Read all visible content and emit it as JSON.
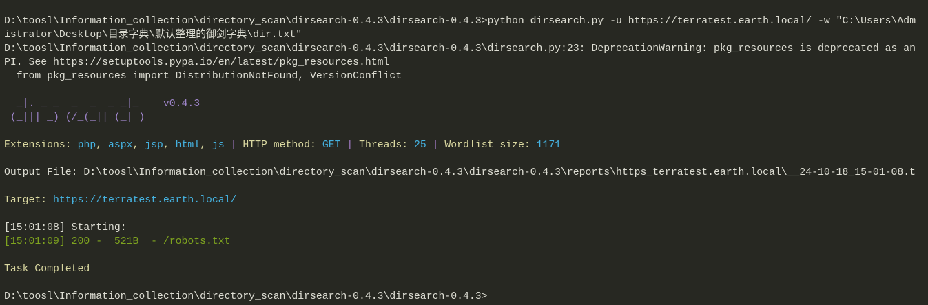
{
  "command": {
    "prompt": "D:\\toosl\\Information_collection\\directory_scan\\dirsearch-0.4.3\\dirsearch-0.4.3>",
    "text_line1": "python dirsearch.py -u https://terratest.earth.local/ -w \"C:\\Users\\Adm",
    "text_line2": "istrator\\Desktop\\目录字典\\默认整理的御剑字典\\dir.txt\""
  },
  "warning": {
    "line1": "D:\\toosl\\Information_collection\\directory_scan\\dirsearch-0.4.3\\dirsearch-0.4.3\\dirsearch.py:23: DeprecationWarning: pkg_resources is deprecated as an",
    "line2": "PI. See https://setuptools.pypa.io/en/latest/pkg_resources.html",
    "line3": "  from pkg_resources import DistributionNotFound, VersionConflict"
  },
  "banner": {
    "art_line1": "  _|. _ _  _  _  _ _|_    ",
    "version": "v0.4.3",
    "art_line2": " (_||| _) (/_(_|| (_| )"
  },
  "config": {
    "extensions_label": "Extensions: ",
    "extensions": [
      "php",
      "aspx",
      "jsp",
      "html",
      "js"
    ],
    "sep": ", ",
    "pipe": " | ",
    "method_label": "HTTP method: ",
    "method": "GET",
    "threads_label": "Threads: ",
    "threads": "25",
    "wordlist_label": "Wordlist size: ",
    "wordlist_size": "1171"
  },
  "output_file": "Output File: D:\\toosl\\Information_collection\\directory_scan\\dirsearch-0.4.3\\dirsearch-0.4.3\\reports\\https_terratest.earth.local\\__24-10-18_15-01-08.t",
  "target": {
    "label": "Target: ",
    "url": "https://terratest.earth.local/"
  },
  "scan": {
    "start": "[15:01:08] Starting: ",
    "result": "[15:01:09] 200 -  521B  - /robots.txt"
  },
  "status": "Task Completed",
  "final_prompt": "D:\\toosl\\Information_collection\\directory_scan\\dirsearch-0.4.3\\dirsearch-0.4.3>"
}
